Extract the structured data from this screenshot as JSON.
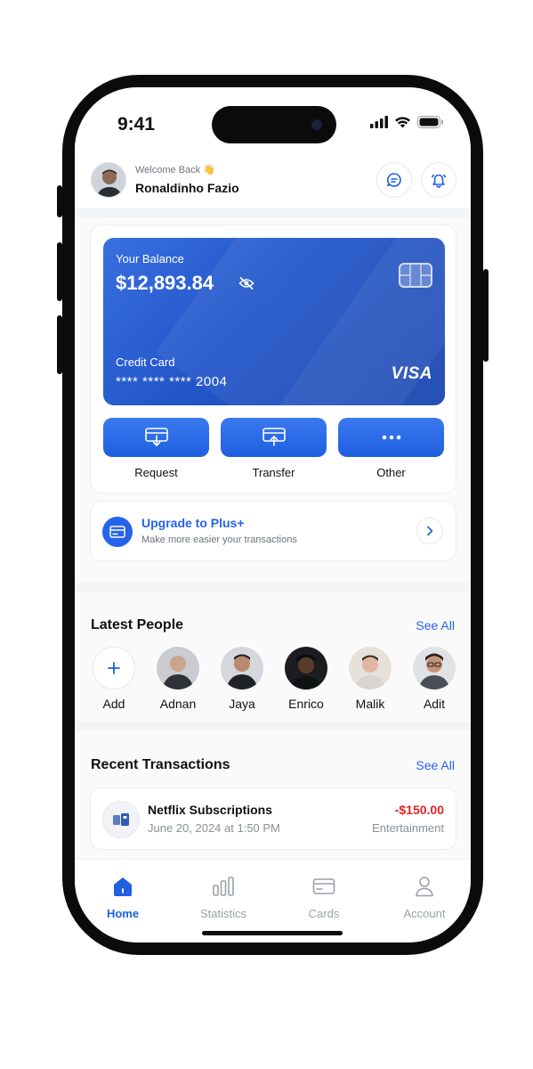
{
  "status_bar": {
    "time": "9:41"
  },
  "header": {
    "welcome": "Welcome Back 👋",
    "user_name": "Ronaldinho Fazio"
  },
  "balance_card": {
    "balance_label": "Your Balance",
    "balance_amount": "$12,893.84",
    "card_type_label": "Credit Card",
    "card_number": "**** **** **** 2004",
    "brand": "VISA"
  },
  "actions": [
    {
      "label": "Request",
      "icon": "download-tray-icon"
    },
    {
      "label": "Transfer",
      "icon": "upload-tray-icon"
    },
    {
      "label": "Other",
      "icon": "more-dots-icon"
    }
  ],
  "upgrade": {
    "title": "Upgrade to Plus+",
    "subtitle": "Make more easier your transactions"
  },
  "latest_people": {
    "title": "Latest People",
    "see_all": "See All",
    "people": [
      {
        "name": "Add"
      },
      {
        "name": "Adnan"
      },
      {
        "name": "Jaya"
      },
      {
        "name": "Enrico"
      },
      {
        "name": "Malik"
      },
      {
        "name": "Adit"
      }
    ]
  },
  "recent_transactions": {
    "title": "Recent Transactions",
    "see_all": "See All",
    "items": [
      {
        "title": "Netflix Subscriptions",
        "date": "June 20, 2024 at 1:50 PM",
        "amount": "-$150.00",
        "category": "Entertainment"
      }
    ]
  },
  "tab_bar": {
    "tabs": [
      {
        "label": "Home",
        "active": true
      },
      {
        "label": "Statistics",
        "active": false
      },
      {
        "label": "Cards",
        "active": false
      },
      {
        "label": "Account",
        "active": false
      }
    ]
  },
  "colors": {
    "accent": "#1f5fe0",
    "negative": "#e02424",
    "muted": "#9aa0a8"
  }
}
